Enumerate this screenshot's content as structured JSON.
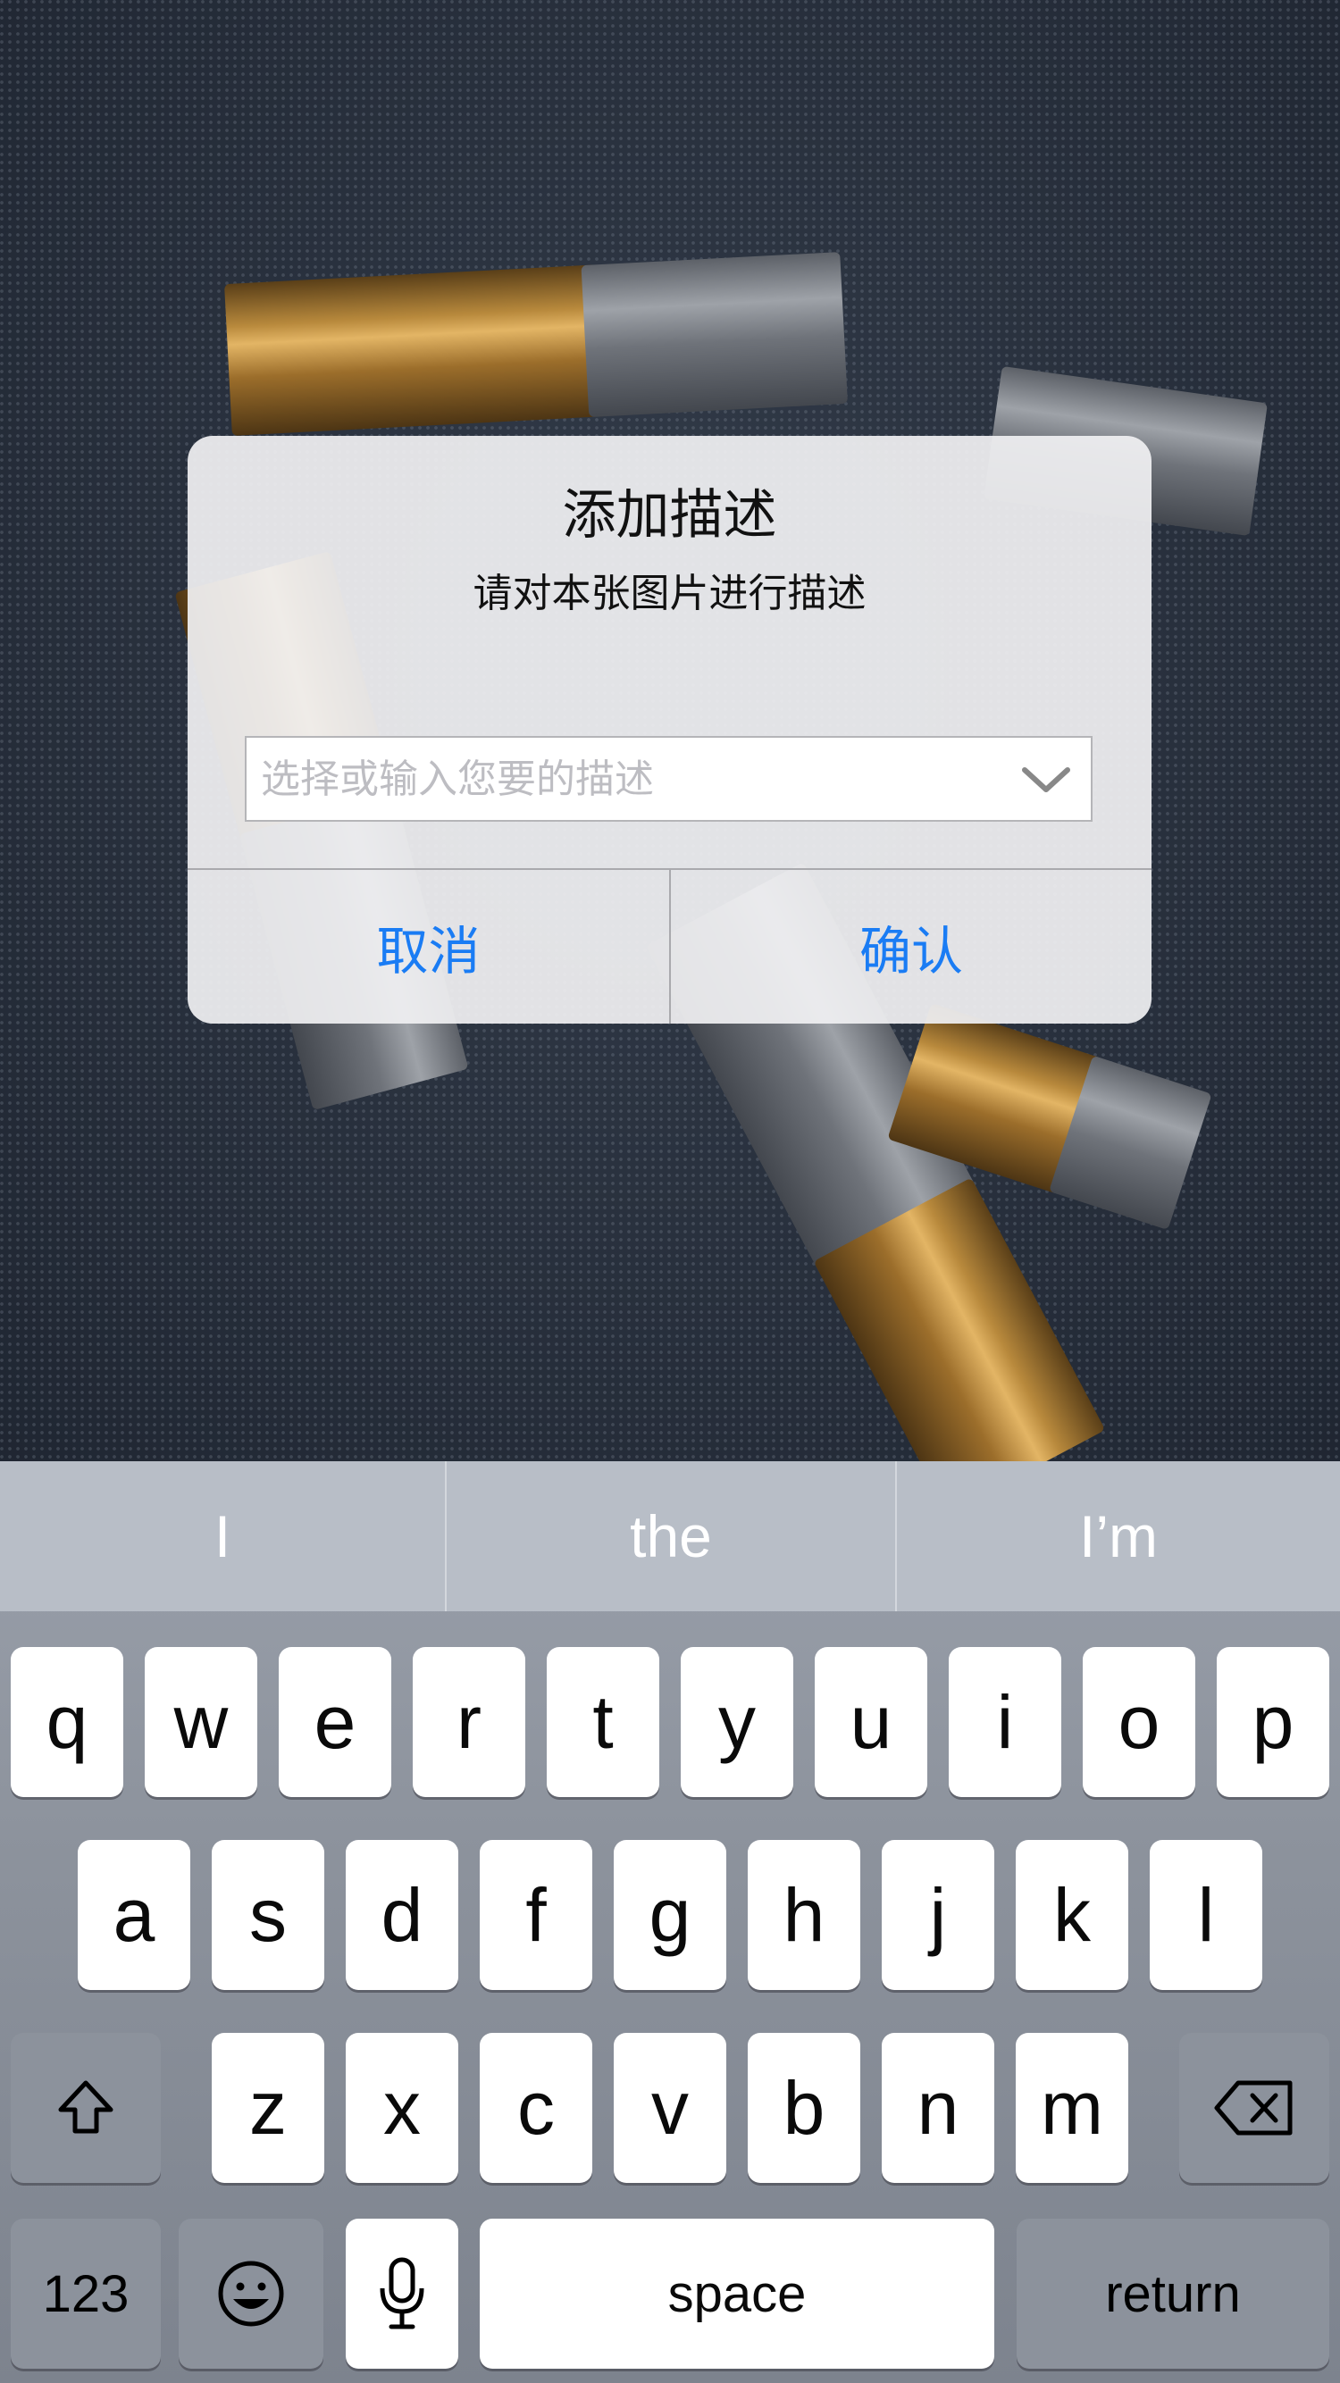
{
  "alert": {
    "title": "添加描述",
    "message": "请对本张图片进行描述",
    "field": {
      "value": "",
      "placeholder": "选择或输入您要的描述",
      "icon": "chevron-down-icon"
    },
    "cancel_label": "取消",
    "confirm_label": "确认",
    "accent_color": "#1a7cf4"
  },
  "keyboard": {
    "suggestions": [
      "I",
      "the",
      "I’m"
    ],
    "row1": [
      "q",
      "w",
      "e",
      "r",
      "t",
      "y",
      "u",
      "i",
      "o",
      "p"
    ],
    "row2": [
      "a",
      "s",
      "d",
      "f",
      "g",
      "h",
      "j",
      "k",
      "l"
    ],
    "row3": [
      "z",
      "x",
      "c",
      "v",
      "b",
      "n",
      "m"
    ],
    "shift_icon": "shift-icon",
    "delete_icon": "delete-icon",
    "numbers_label": "123",
    "emoji_icon": "emoji-icon",
    "mic_icon": "microphone-icon",
    "space_label": "space",
    "return_label": "return"
  }
}
